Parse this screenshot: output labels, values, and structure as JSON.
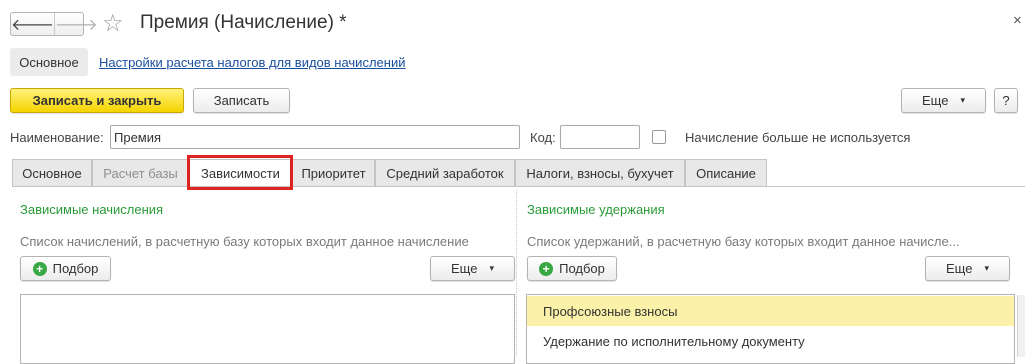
{
  "window": {
    "title": "Премия (Начисление) *",
    "back_icon": "🡐",
    "forward_icon": "🡒",
    "star_icon": "☆",
    "close_icon": "×"
  },
  "sections": {
    "main_label": "Основное",
    "link_label": "Настройки расчета налогов для видов начислений"
  },
  "toolbar": {
    "save_close_label": "Записать и закрыть",
    "save_label": "Записать",
    "more_label": "Еще",
    "help_label": "?"
  },
  "form": {
    "name_label": "Наименование:",
    "name_value": "Премия",
    "code_label": "Код:",
    "code_value": "",
    "not_used_label": "Начисление больше не используется"
  },
  "tabs": [
    {
      "label": "Основное"
    },
    {
      "label": "Расчет базы"
    },
    {
      "label": "Зависимости"
    },
    {
      "label": "Приоритет"
    },
    {
      "label": "Средний заработок"
    },
    {
      "label": "Налоги, взносы, бухучет"
    },
    {
      "label": "Описание"
    }
  ],
  "left_panel": {
    "title": "Зависимые начисления",
    "description": "Список начислений, в расчетную базу которых входит данное начисление",
    "pick_label": "Подбор",
    "more_label": "Еще"
  },
  "right_panel": {
    "title": "Зависимые удержания",
    "description": "Список удержаний, в расчетную базу которых входит данное начисле...",
    "pick_label": "Подбор",
    "more_label": "Еще",
    "items": [
      {
        "label": "Профсоюзные взносы"
      },
      {
        "label": "Удержание по исполнительному документу"
      }
    ]
  },
  "colors": {
    "accent_yellow": "#f5d400",
    "highlight_red": "#e0241f",
    "section_green": "#2a9a38",
    "selected_row": "#fbf1a9",
    "link_blue": "#1a4fa0"
  }
}
